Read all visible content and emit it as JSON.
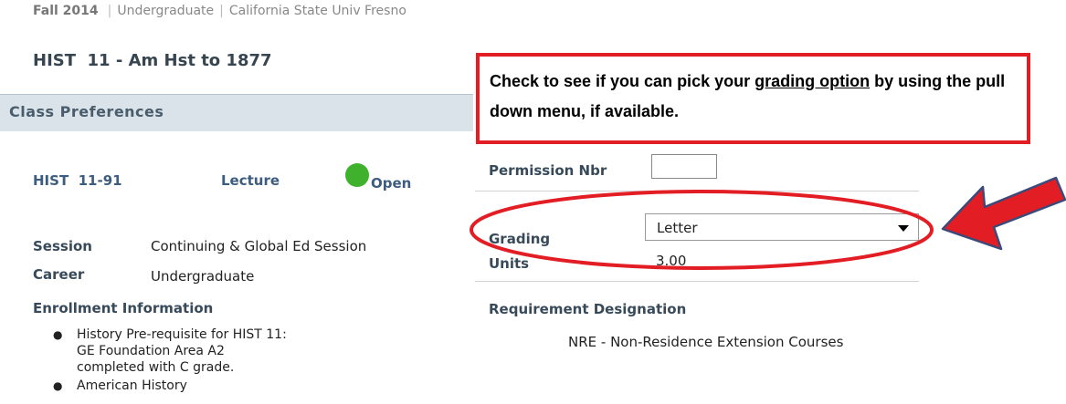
{
  "term": {
    "name": "Fall 2014",
    "career": "Undergraduate",
    "institution": "California State Univ  Fresno"
  },
  "course": {
    "title": "HIST  11 - Am Hst to 1877",
    "preferences_header": "Class Preferences",
    "section": "HIST  11-91",
    "component": "Lecture",
    "status": "Open",
    "session_label": "Session",
    "session_value": "Continuing & Global Ed Session",
    "career_label": "Career",
    "career_value": "Undergraduate",
    "enrollment_label": "Enrollment Information",
    "enrollment_items": [
      "History Pre-requisite for HIST 11: GE Foundation Area A2 completed with C grade.",
      "American History"
    ]
  },
  "preferences": {
    "permission_label": "Permission Nbr",
    "permission_value": "",
    "grading_label": "Grading",
    "grading_selected": "Letter",
    "units_label": "Units",
    "units_value": "3.00",
    "requirement_label": "Requirement Designation",
    "requirement_value": "NRE - Non-Residence Extension Courses"
  },
  "annotation": {
    "text_before": "Check to see if you can pick your ",
    "text_underlined": "grading option",
    "text_after": " by using the pull down menu, if available.",
    "color": "#e21d24"
  },
  "colors": {
    "status_open": "#3fb12c",
    "header_bar": "#dbe3ea",
    "link_blue": "#3d5d80"
  }
}
